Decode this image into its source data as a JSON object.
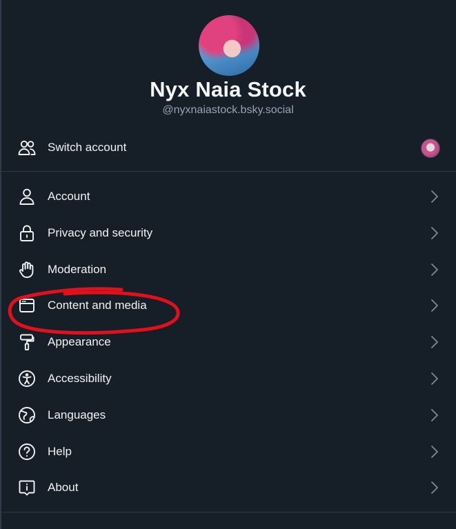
{
  "profile": {
    "display_name": "Nyx Naia Stock",
    "handle": "@nyxnaiastock.bsky.social"
  },
  "switch_account": {
    "label": "Switch account"
  },
  "settings_items": [
    {
      "label": "Account",
      "icon": "person-icon"
    },
    {
      "label": "Privacy and security",
      "icon": "lock-icon"
    },
    {
      "label": "Moderation",
      "icon": "hand-icon"
    },
    {
      "label": "Content and media",
      "icon": "window-icon"
    },
    {
      "label": "Appearance",
      "icon": "paint-roller-icon"
    },
    {
      "label": "Accessibility",
      "icon": "accessibility-icon"
    },
    {
      "label": "Languages",
      "icon": "globe-icon"
    },
    {
      "label": "Help",
      "icon": "question-circle-icon"
    },
    {
      "label": "About",
      "icon": "info-bubble-icon"
    }
  ],
  "colors": {
    "background": "#161e27",
    "text": "#f1f3f5",
    "muted": "#97a4b3",
    "annotation": "#e0101c"
  }
}
